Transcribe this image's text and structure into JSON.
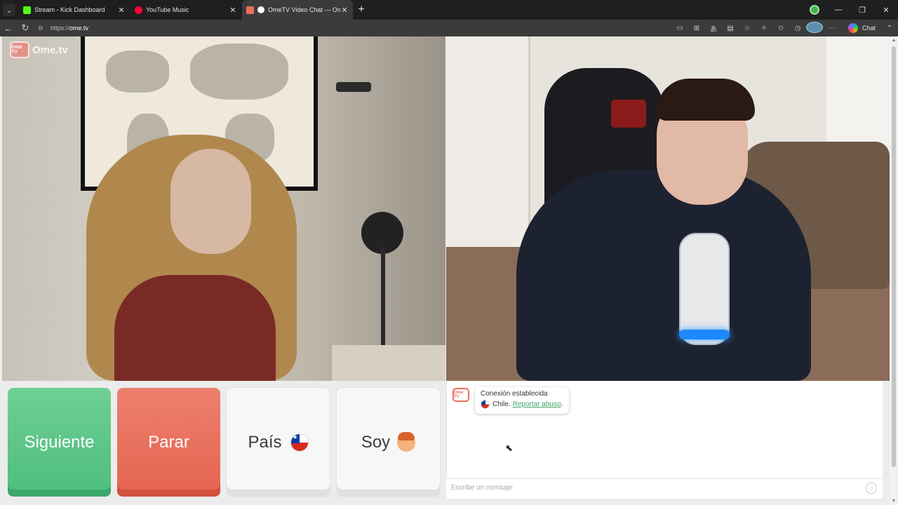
{
  "browser": {
    "tabs": [
      {
        "title": "Stream - Kick Dashboard",
        "favicon_color": "#53fc18",
        "active": false
      },
      {
        "title": "YouTube Music",
        "favicon_color": "#ff0033",
        "active": false
      },
      {
        "title": "OmeTV Video Chat — Omegle",
        "favicon_color": "#ea6f5c",
        "active": true
      }
    ],
    "url_prefix": "https://",
    "url_host": "ome.tv",
    "chat_button": "Chat"
  },
  "page": {
    "logo_text": "Ome.tv",
    "logo_badge": "Ome TV",
    "buttons": {
      "next": "Siguiente",
      "stop": "Parar",
      "country": "País",
      "gender": "Soy"
    },
    "chat": {
      "system_title": "Conexión establecida",
      "country": "Chile.",
      "report_link": "Reportar abuso",
      "report_suffix": ".",
      "input_placeholder": "Escribe un mensaje"
    },
    "accent_green": "#4dbd7c",
    "accent_red": "#e4644f"
  }
}
